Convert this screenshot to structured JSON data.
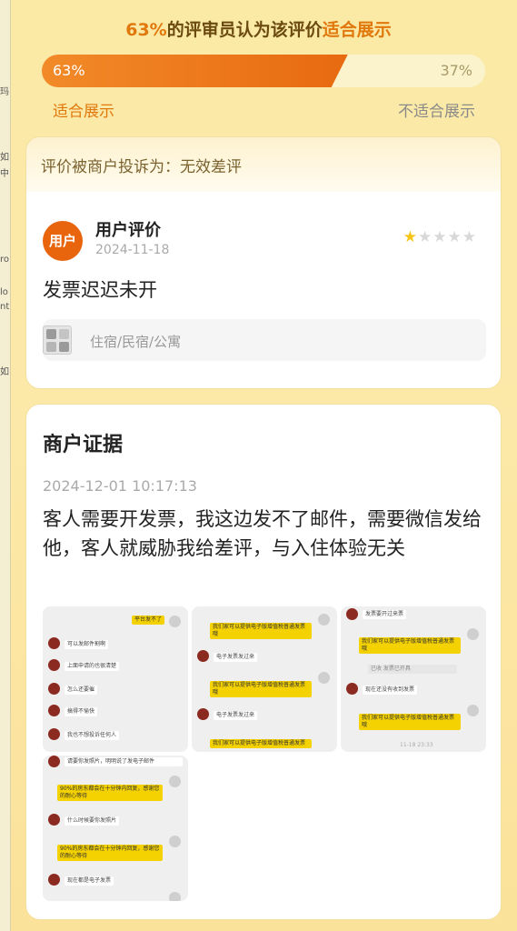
{
  "left_strip": [
    "玛",
    "如",
    "中",
    "ro",
    "lo",
    "nt",
    "如"
  ],
  "vote": {
    "header_pct": "63%",
    "header_middle": "的评审员认为该评价",
    "header_accent": "适合展示",
    "left_pct": "63%",
    "right_pct": "37%",
    "left_fraction": 0.63,
    "left_label": "适合展示",
    "right_label": "不适合展示"
  },
  "review": {
    "complaint": "评价被商户投诉为：无效差评",
    "avatar_text": "用户",
    "user_name": "用户评价",
    "date": "2024-11-18",
    "rating": 1,
    "rating_max": 5,
    "text": "发票迟迟未开",
    "category": "住宿/民宿/公寓"
  },
  "evidence": {
    "title": "商户证据",
    "time": "2024-12-01 10:17:13",
    "text": "客人需要开发票，我这边发不了邮件，需要微信发给他，客人就威胁我给差评，与入住体验无关",
    "thumbs": [
      {
        "messages": [
          "平台发不了",
          "可以发邮件割啊",
          "上面申请的也很清楚",
          "怎么还要催",
          "搞得不愉快",
          "我也不想投诉任何人"
        ]
      },
      {
        "messages": [
          "我们家可以提供电子版增值税普通发票哦",
          "电子发票发过来",
          "我们家可以提供电子版增值税普通发票哦",
          "电子发票发过来",
          "我们家可以提供电子版增值税普通发票"
        ]
      },
      {
        "messages": [
          "发票要开过来票",
          "我们家可以提供电子版增值税普通发票哦",
          "已收 发票已开具",
          "现在还没有收到发票",
          "我们家可以提供电子版增值税普通发票哦",
          "11-18 23:33"
        ]
      },
      {
        "messages": [
          "请要你发照片，明明说了发电子邮件",
          "90%的房东都会在十分钟内回复，感谢您的耐心等待",
          "什么时候要你发照片",
          "90%的房东都会在十分钟内回复，感谢您的耐心等待",
          "现在都是电子发票"
        ]
      }
    ]
  },
  "colors": {
    "accent": "#e1780c",
    "bar_fill": "#e86a10",
    "star_on": "#f5c518",
    "avatar": "#e8650e"
  }
}
